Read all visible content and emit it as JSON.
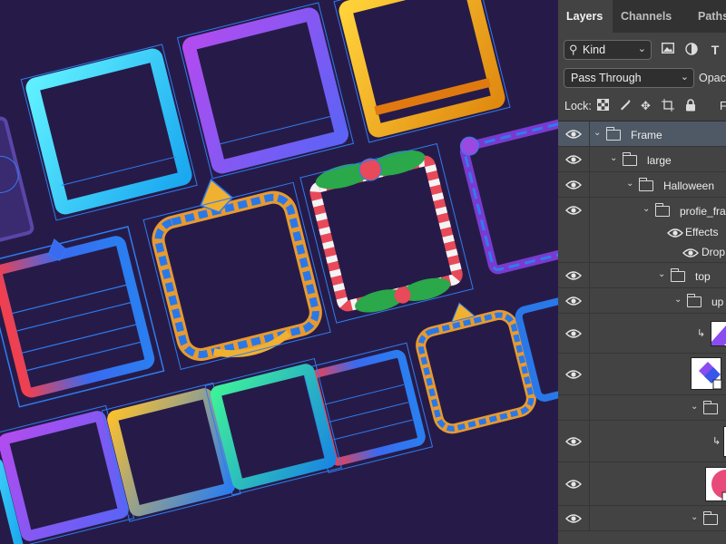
{
  "panel": {
    "tabs": [
      {
        "label": "Layers",
        "active": true
      },
      {
        "label": "Channels",
        "active": false
      },
      {
        "label": "Paths",
        "active": false
      }
    ],
    "filter": {
      "kind_label": "Kind",
      "icons": [
        "image-filter-icon",
        "adjustment-filter-icon",
        "type-filter-icon"
      ]
    },
    "blend_mode": "Pass Through",
    "opacity_label": "Opacity:",
    "lock": {
      "label": "Lock:",
      "icons": [
        "lock-transparent-pixels-icon",
        "lock-image-pixels-icon",
        "lock-position-icon",
        "lock-artboard-icon",
        "lock-all-icon"
      ],
      "fill_label": "F"
    },
    "layers": [
      {
        "name": "Frame",
        "kind": "group",
        "expanded": true,
        "selected": true
      },
      {
        "name": "large",
        "kind": "group",
        "expanded": true
      },
      {
        "name": "Halloween",
        "kind": "group",
        "expanded": true
      },
      {
        "name": "profie_frame",
        "kind": "group",
        "expanded": true
      },
      {
        "name": "Effects",
        "kind": "effects"
      },
      {
        "name": "Drop Shadow",
        "kind": "effect"
      },
      {
        "name": "top",
        "kind": "group",
        "expanded": true
      },
      {
        "name": "up",
        "kind": "group",
        "expanded": true
      },
      {
        "name": "",
        "kind": "clipped-layer",
        "thumb": "purple-shape"
      },
      {
        "name": "",
        "kind": "shape-layer",
        "thumb": "blue-purple-shape"
      },
      {
        "name": "",
        "kind": "group",
        "expanded": true
      },
      {
        "name": "",
        "kind": "clipped-layer",
        "thumb": "blank"
      },
      {
        "name": "",
        "kind": "shape-layer",
        "thumb": "pink-shape"
      },
      {
        "name": "",
        "kind": "group",
        "expanded": true
      }
    ]
  },
  "colors": {
    "canvas_bg": "#261b48",
    "panel_bg": "#434343",
    "selected_row": "#4f5966",
    "selection_outline": "#2f7cf0"
  }
}
